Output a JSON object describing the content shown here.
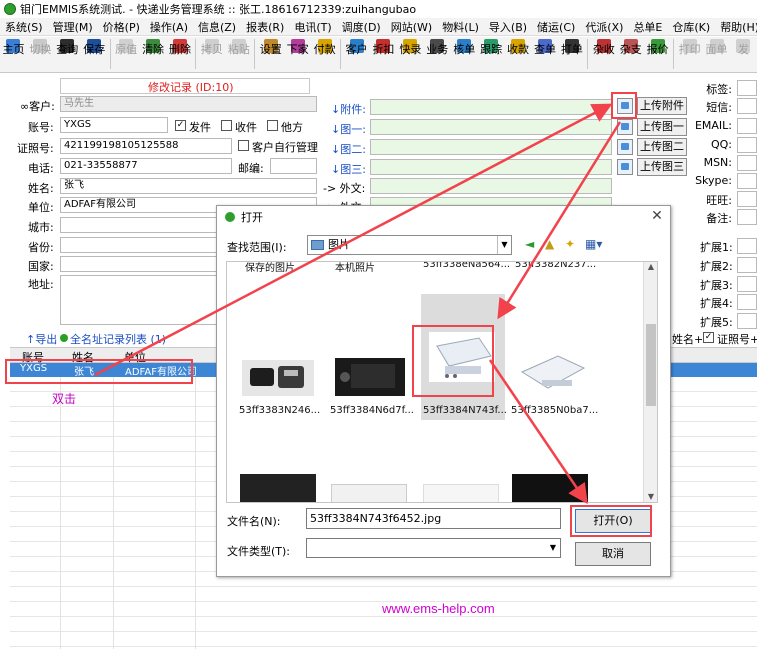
{
  "window": {
    "title": "钼门EMMIS系统测试. - 快递业务管理系统 :: 张工.18616712339:zuihangubao"
  },
  "menubar": [
    "系统(S)",
    "管理(M)",
    "价格(P)",
    "操作(A)",
    "信息(Z)",
    "报表(R)",
    "电讯(T)",
    "调度(D)",
    "网站(W)",
    "物料(L)",
    "导入(B)",
    "储运(C)",
    "代派(X)",
    "总单E",
    "仓库(K)",
    "帮助(H)"
  ],
  "toolbar": [
    {
      "label": "主页",
      "icon": "home-icon",
      "enabled": true
    },
    {
      "label": "切换",
      "icon": "switch-icon",
      "enabled": false
    },
    {
      "label": "查询",
      "icon": "binoculars-icon",
      "enabled": true
    },
    {
      "label": "保存",
      "icon": "save-icon",
      "enabled": true
    },
    {
      "label": "原值",
      "icon": "restore-icon",
      "enabled": false
    },
    {
      "label": "清除",
      "icon": "clear-icon",
      "enabled": true
    },
    {
      "label": "删除",
      "icon": "delete-icon",
      "enabled": true
    },
    {
      "label": "拷贝",
      "icon": "copy-icon",
      "enabled": false
    },
    {
      "label": "粘贴",
      "icon": "paste-icon",
      "enabled": false
    },
    {
      "label": "设置",
      "icon": "settings-icon",
      "enabled": true
    },
    {
      "label": "下家",
      "icon": "next-party-icon",
      "enabled": true
    },
    {
      "label": "付款",
      "icon": "payment-icon",
      "enabled": true
    },
    {
      "label": "客户",
      "icon": "customers-icon",
      "enabled": true
    },
    {
      "label": "折扣",
      "icon": "discount-icon",
      "enabled": true
    },
    {
      "label": "快录",
      "icon": "quick-entry-icon",
      "enabled": true
    },
    {
      "label": "业务",
      "icon": "business-icon",
      "enabled": true
    },
    {
      "label": "核单",
      "icon": "check-order-icon",
      "enabled": true
    },
    {
      "label": "跟踪",
      "icon": "track-icon",
      "enabled": true
    },
    {
      "label": "收款",
      "icon": "receive-icon",
      "enabled": true
    },
    {
      "label": "查单",
      "icon": "find-order-icon",
      "enabled": true
    },
    {
      "label": "打单",
      "icon": "print-order-icon",
      "enabled": true
    },
    {
      "label": "杂收",
      "icon": "misc-receive-icon",
      "enabled": true
    },
    {
      "label": "杂支",
      "icon": "misc-pay-icon",
      "enabled": true
    },
    {
      "label": "报价",
      "icon": "quote-icon",
      "enabled": true
    },
    {
      "label": "打印",
      "icon": "print-icon",
      "enabled": false
    },
    {
      "label": "面单",
      "icon": "waybill-icon",
      "enabled": false
    },
    {
      "label": "发",
      "icon": "send-icon",
      "enabled": false
    }
  ],
  "form": {
    "header": "修改记录 (ID:10)",
    "customer_label": "∞客户:",
    "customer_value": "马先生",
    "account_label": "账号:",
    "account_value": "YXGS",
    "send_label": "发件",
    "receive_label": "收件",
    "other_label": "他方",
    "id_label": "证照号:",
    "id_value": "421199198105125588",
    "self_manage_label": "客户自行管理",
    "phone_label": "电话:",
    "phone_value": "021-33558877",
    "postcode_label": "邮编:",
    "name_label": "姓名:",
    "name_value": "张飞",
    "company_label": "单位:",
    "company_value": "ADFAF有限公司",
    "city_label": "城市:",
    "province_label": "省份:",
    "country_label": "国家:",
    "address_label": "地址:",
    "attach_label": "↓附件:",
    "pic1_label": "↓图一:",
    "pic2_label": "↓图二:",
    "pic3_label": "↓图三:",
    "foreign_label": "-> 外文:",
    "foreign2_label": "-> 外文:",
    "upload_attach": "上传附件",
    "upload_pic1": "上传图一",
    "upload_pic2": "上传图二",
    "upload_pic3": "上传图三",
    "right_labels": [
      "标签:",
      "短信:",
      "EMAIL:",
      "QQ:",
      "MSN:",
      "Skype:",
      "旺旺:",
      "备注:"
    ],
    "ext_labels": [
      "扩展1:",
      "扩展2:",
      "扩展3:",
      "扩展4:",
      "扩展5:"
    ]
  },
  "list": {
    "export_label": "↑导出",
    "all_records_label": "全名址记录列表 (1)",
    "name_plus": "姓名+",
    "id_plus": "证照号+",
    "columns": [
      "账号",
      "姓名",
      "单位"
    ],
    "rows": [
      {
        "account": "YXGS",
        "name": "张飞",
        "company": "ADFAF有限公司"
      }
    ]
  },
  "dialog": {
    "title": "打开",
    "look_in_label": "查找范围(I):",
    "look_in_value": "图片",
    "top_files": [
      "保存的图片",
      "本机照片",
      "53ff338eNa564...",
      "53ff3382N237..."
    ],
    "files": [
      "53ff3383N246...",
      "53ff3384N6d7f...",
      "53ff3384N743f...",
      "53ff3385N0ba7..."
    ],
    "file_name_label": "文件名(N):",
    "file_name_value": "53ff3384N743f6452.jpg",
    "file_type_label": "文件类型(T):",
    "open_button": "打开(O)",
    "cancel_button": "取消"
  },
  "annotations": {
    "double_click": "双击",
    "footer_link": "www.ems-help.com"
  },
  "colors": {
    "annotation_red": "#f2424c",
    "selected_row": "#3d86d6",
    "field_green": "#e9f8e4",
    "footer_magenta": "#d000d0"
  }
}
